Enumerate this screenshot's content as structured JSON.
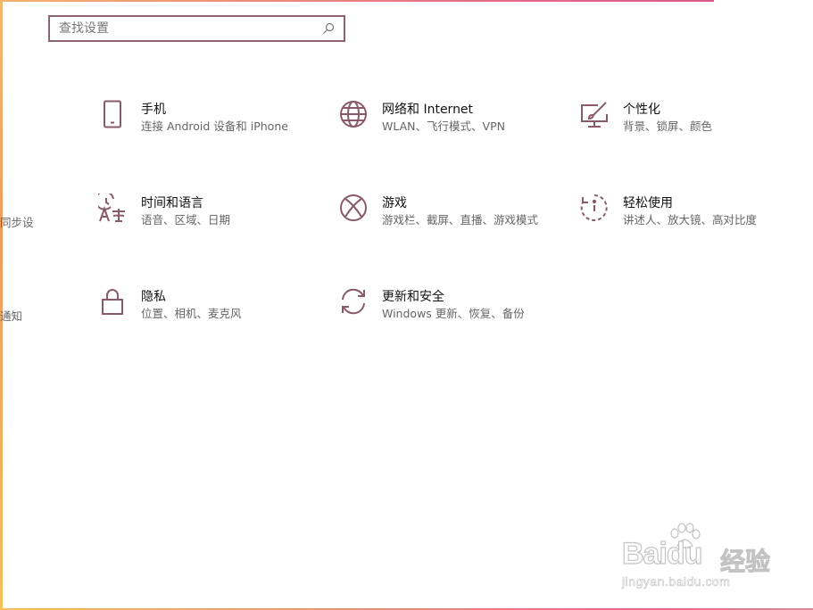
{
  "search": {
    "placeholder": "查找设置"
  },
  "tiles": [
    {
      "title": "手机",
      "desc": "连接 Android 设备和 iPhone"
    },
    {
      "title": "网络和 Internet",
      "desc": "WLAN、飞行模式、VPN"
    },
    {
      "title": "个性化",
      "desc": "背景、锁屏、颜色"
    },
    {
      "title": "时间和语言",
      "desc": "语音、区域、日期"
    },
    {
      "title": "游戏",
      "desc": "游戏栏、截屏、直播、游戏模式"
    },
    {
      "title": "轻松使用",
      "desc": "讲述人、放大镜、高对比度"
    },
    {
      "title": "隐私",
      "desc": "位置、相机、麦克风"
    },
    {
      "title": "更新和安全",
      "desc": "Windows 更新、恢复、备份"
    }
  ],
  "partials": [
    "同步设",
    "通知"
  ],
  "watermark": {
    "logo": "Baidu",
    "cn": "经验",
    "url": "jingyan.baidu.com"
  },
  "colors": {
    "accent": "#8e6471",
    "icon": "#8a5a68"
  }
}
